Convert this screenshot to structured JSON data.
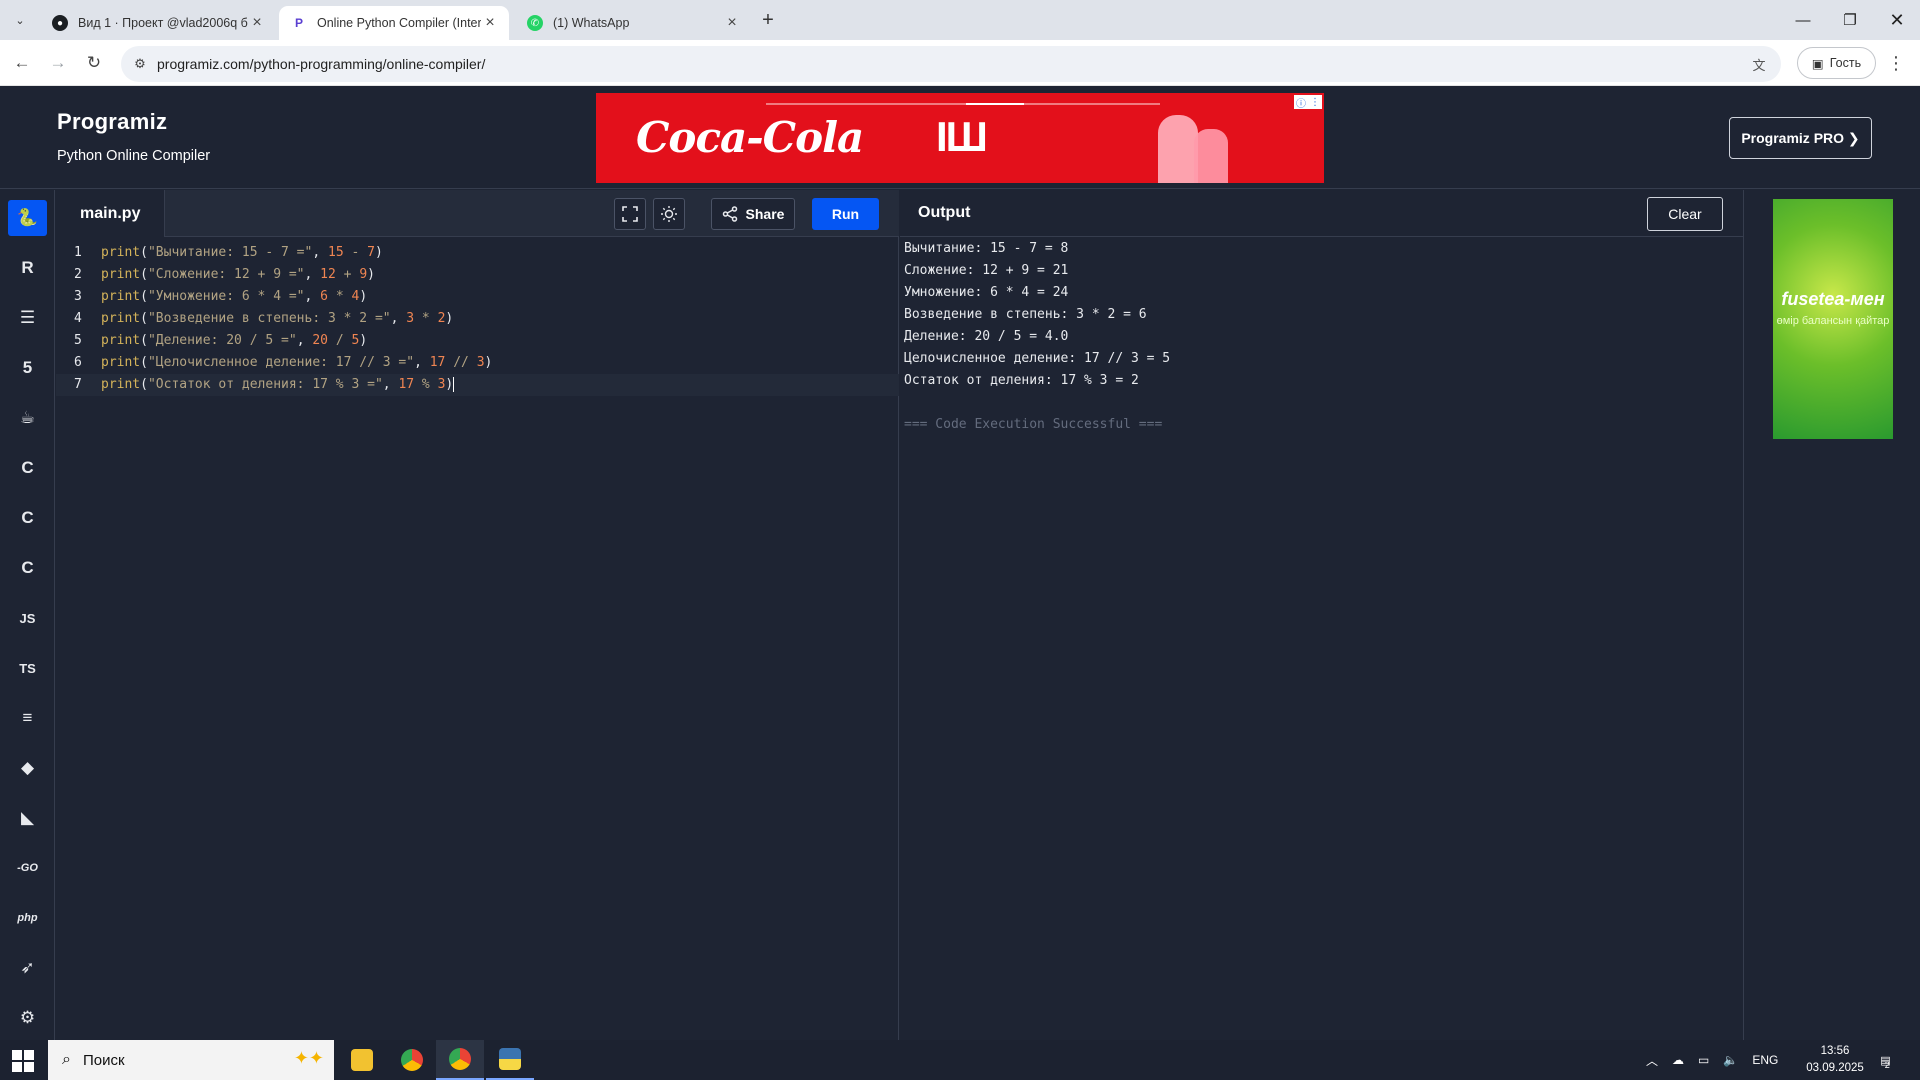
{
  "browser": {
    "tabs": [
      {
        "title": "Вид 1 · Проект @vlad2006q бе",
        "favicon": "github-icon"
      },
      {
        "title": "Online Python Compiler (Interp",
        "favicon": "programiz-icon"
      },
      {
        "title": "(1) WhatsApp",
        "favicon": "whatsapp-icon"
      }
    ],
    "url": "programiz.com/python-programming/online-compiler/",
    "profile_label": "Гость"
  },
  "site": {
    "logo": "Programiz",
    "subtitle": "Python Online Compiler",
    "pro_button": "Programiz PRO ❯",
    "ad_brand": "Coca-Cola",
    "ad_center": "ІШ",
    "side_ad_brand": "fusetea-мен",
    "side_ad_tagline": "өмір балансын қайтар"
  },
  "editor": {
    "file_name": "main.py",
    "share_label": "Share",
    "run_label": "Run",
    "lines": [
      {
        "n": "1",
        "str": "\"Вычитание: 15 - 7 =\"",
        "expr": [
          "15",
          " - ",
          "7"
        ]
      },
      {
        "n": "2",
        "str": "\"Сложение: 12 + 9 =\"",
        "expr": [
          "12",
          " + ",
          "9"
        ]
      },
      {
        "n": "3",
        "str": "\"Умножение: 6 * 4 =\"",
        "expr": [
          "6",
          " * ",
          "4"
        ]
      },
      {
        "n": "4",
        "str": "\"Возведение в степень: 3 * 2 =\"",
        "expr": [
          "3",
          " * ",
          "2"
        ]
      },
      {
        "n": "5",
        "str": "\"Деление: 20 / 5 =\"",
        "expr": [
          "20",
          " / ",
          "5"
        ]
      },
      {
        "n": "6",
        "str": "\"Целочисленное деление: 17 // 3 =\"",
        "expr": [
          "17",
          " // ",
          "3"
        ]
      },
      {
        "n": "7",
        "str": "\"Остаток от деления: 17 % 3 =\"",
        "expr": [
          "17",
          " % ",
          "3"
        ]
      }
    ]
  },
  "output": {
    "title": "Output",
    "clear_label": "Clear",
    "lines": [
      "Вычитание: 15 - 7 = 8",
      "Сложение: 12 + 9 = 21",
      "Умножение: 6 * 4 = 24",
      "Возведение в степень: 3 * 2 = 6",
      "Деление: 20 / 5 = 4.0",
      "Целочисленное деление: 17 // 3 = 5",
      "Остаток от деления: 17 % 3 = 2"
    ],
    "status": "=== Code Execution Successful ==="
  },
  "sidebar": {
    "languages": [
      {
        "name": "python-icon",
        "label": ""
      },
      {
        "name": "r-icon",
        "label": ""
      },
      {
        "name": "sql-icon",
        "label": ""
      },
      {
        "name": "html5-icon",
        "label": ""
      },
      {
        "name": "java-icon",
        "label": ""
      },
      {
        "name": "c-icon",
        "label": ""
      },
      {
        "name": "cpp-icon",
        "label": ""
      },
      {
        "name": "csharp-icon",
        "label": ""
      },
      {
        "name": "javascript-icon",
        "label": "JS"
      },
      {
        "name": "typescript-icon",
        "label": "TS"
      },
      {
        "name": "scala-icon",
        "label": ""
      },
      {
        "name": "ruby-icon",
        "label": ""
      },
      {
        "name": "kotlin-icon",
        "label": ""
      },
      {
        "name": "go-icon",
        "label": "-GO"
      },
      {
        "name": "php-icon",
        "label": "php"
      },
      {
        "name": "swift-icon",
        "label": ""
      },
      {
        "name": "rust-icon",
        "label": ""
      }
    ]
  },
  "taskbar": {
    "search_placeholder": "Поиск",
    "language": "ENG",
    "time": "13:56",
    "date": "03.09.2025",
    "notifications": "2"
  },
  "colors": {
    "accent": "#0556f3",
    "background": "#1e2433",
    "string": "#b2a383",
    "number": "#f08552",
    "function": "#d4b35a"
  }
}
